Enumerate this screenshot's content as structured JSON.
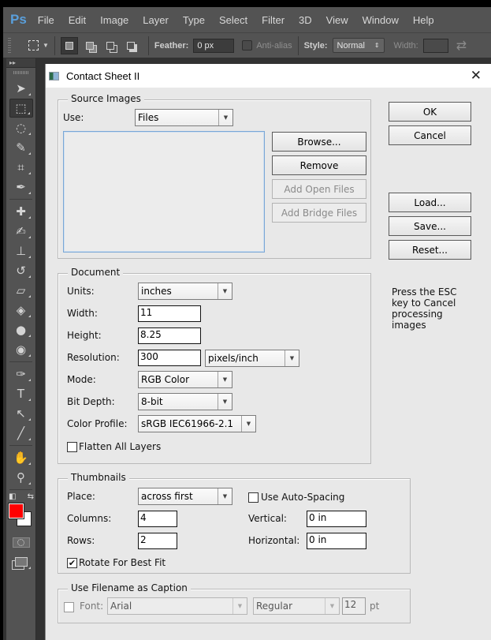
{
  "app": {
    "logo": "Ps",
    "menu": [
      "File",
      "Edit",
      "Image",
      "Layer",
      "Type",
      "Select",
      "Filter",
      "3D",
      "View",
      "Window",
      "Help"
    ]
  },
  "options_bar": {
    "feather_label": "Feather:",
    "feather_value": "0 px",
    "antialias_label": "Anti-alias",
    "style_label": "Style:",
    "style_value": "Normal",
    "width_label": "Width:"
  },
  "toolbar": {
    "collapse_glyph": "▸▸",
    "tools": [
      {
        "name": "move-tool",
        "glyph": "➤"
      },
      {
        "name": "rectangular-marquee-tool",
        "glyph": "⬚",
        "active": true
      },
      {
        "name": "lasso-tool",
        "glyph": "◌"
      },
      {
        "name": "quick-selection-tool",
        "glyph": "✎"
      },
      {
        "name": "crop-tool",
        "glyph": "⌗"
      },
      {
        "name": "eyedropper-tool",
        "glyph": "✒"
      },
      {
        "name": "spot-healing-tool",
        "glyph": "✚"
      },
      {
        "name": "brush-tool",
        "glyph": "✍"
      },
      {
        "name": "clone-stamp-tool",
        "glyph": "⊥"
      },
      {
        "name": "history-brush-tool",
        "glyph": "↺"
      },
      {
        "name": "eraser-tool",
        "glyph": "▱"
      },
      {
        "name": "paint-bucket-tool",
        "glyph": "◈"
      },
      {
        "name": "blur-tool",
        "glyph": "●"
      },
      {
        "name": "dodge-tool",
        "glyph": "◉"
      },
      {
        "name": "pen-tool",
        "glyph": "✑"
      },
      {
        "name": "type-tool",
        "glyph": "T"
      },
      {
        "name": "path-selection-tool",
        "glyph": "↖"
      },
      {
        "name": "line-tool",
        "glyph": "╱"
      },
      {
        "name": "hand-tool",
        "glyph": "✋"
      },
      {
        "name": "zoom-tool",
        "glyph": "⚲"
      }
    ],
    "foreground_color": "#ff0000",
    "background_color": "#ffffff"
  },
  "dialog": {
    "title": "Contact Sheet II",
    "close_glyph": "✕",
    "buttons": {
      "ok": "OK",
      "cancel": "Cancel",
      "load": "Load...",
      "save": "Save...",
      "reset": "Reset..."
    },
    "note": "Press the ESC key to Cancel processing images",
    "source_images": {
      "title": "Source Images",
      "use_label": "Use:",
      "use_value": "Files",
      "browse": "Browse...",
      "remove": "Remove",
      "add_open_files": "Add Open Files",
      "add_bridge_files": "Add Bridge Files"
    },
    "document": {
      "title": "Document",
      "units_label": "Units:",
      "units_value": "inches",
      "width_label": "Width:",
      "width_value": "11",
      "height_label": "Height:",
      "height_value": "8.25",
      "resolution_label": "Resolution:",
      "resolution_value": "300",
      "resolution_unit": "pixels/inch",
      "mode_label": "Mode:",
      "mode_value": "RGB Color",
      "bit_depth_label": "Bit Depth:",
      "bit_depth_value": "8-bit",
      "color_profile_label": "Color Profile:",
      "color_profile_value": "sRGB IEC61966-2.1",
      "flatten_label": "Flatten All Layers",
      "flatten_checked": false
    },
    "thumbnails": {
      "title": "Thumbnails",
      "place_label": "Place:",
      "place_value": "across first",
      "auto_spacing_label": "Use Auto-Spacing",
      "auto_spacing_checked": false,
      "columns_label": "Columns:",
      "columns_value": "4",
      "rows_label": "Rows:",
      "rows_value": "2",
      "vertical_label": "Vertical:",
      "vertical_value": "0 in",
      "horizontal_label": "Horizontal:",
      "horizontal_value": "0 in",
      "rotate_label": "Rotate For Best Fit",
      "rotate_checked": true
    },
    "caption": {
      "title": "Use Filename as Caption",
      "checked": false,
      "font_label": "Font:",
      "font_value": "Arial",
      "style_value": "Regular",
      "size_value": "12",
      "size_unit": "pt"
    }
  }
}
